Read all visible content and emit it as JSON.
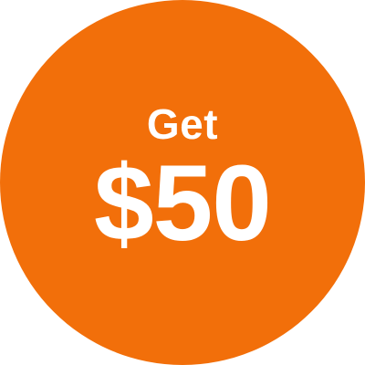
{
  "badge": {
    "background_color": "#f26f0a",
    "text_color": "#ffffff",
    "line1": "Get",
    "line2": "$50"
  }
}
